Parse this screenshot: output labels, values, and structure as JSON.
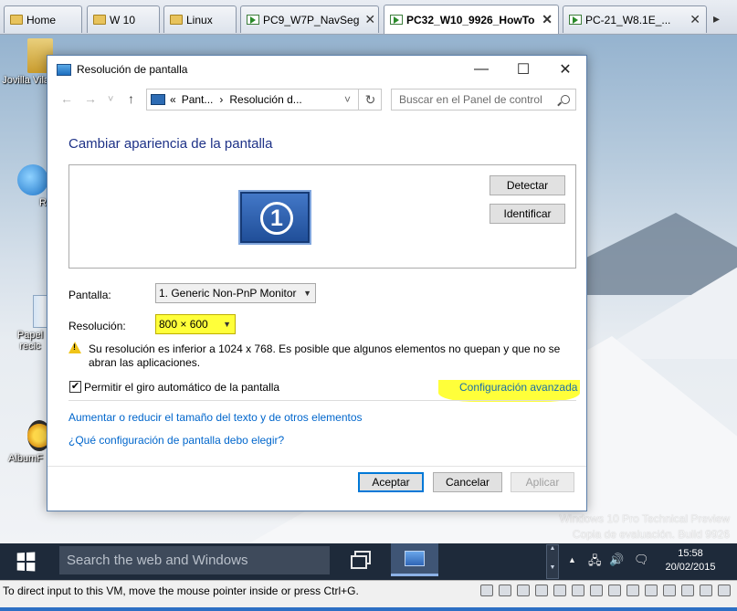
{
  "vm_tabs": [
    {
      "label": "Home",
      "icon": "home-folder-icon",
      "active": false
    },
    {
      "label": "W 10",
      "icon": "folder-icon",
      "active": false
    },
    {
      "label": "Linux",
      "icon": "folder-icon",
      "active": false
    },
    {
      "label": "PC9_W7P_NavSeg",
      "icon": "vm-icon",
      "active": false
    },
    {
      "label": "PC32_W10_9926_HowTo",
      "icon": "vm-running-icon",
      "active": true
    },
    {
      "label": "PC-21_W8.1E_...",
      "icon": "vm-icon",
      "active": false
    }
  ],
  "desktop": {
    "icons": [
      {
        "label": "Jovilla Vilar",
        "icon": "user-folder-icon"
      },
      {
        "label": "R",
        "icon": "network-globe-icon"
      },
      {
        "label": "Papel recic",
        "icon": "recycle-bin-icon"
      },
      {
        "label": "AlbumF",
        "icon": "album-shortcut-icon"
      }
    ],
    "watermark_line1": "Windows 10 Pro Technical Preview",
    "watermark_line2": "Copia de evaluación. Build 9926"
  },
  "window": {
    "title": "Resolución de pantalla",
    "minimize": "—",
    "maximize": "☐",
    "close": "✕",
    "nav_back": "←",
    "nav_forward": "→",
    "nav_recent": "˅",
    "nav_up": "↑",
    "breadcrumb_prefix": "«",
    "breadcrumb_1": "Pant...",
    "breadcrumb_sep": "›",
    "breadcrumb_2": "Resolución d...",
    "breadcrumb_dropdown": "˅",
    "refresh": "↻",
    "search_placeholder": "Buscar en el Panel de control",
    "heading": "Cambiar apariencia de la pantalla",
    "monitor_number": "1",
    "detect_button": "Detectar",
    "identify_button": "Identificar",
    "display_label": "Pantalla:",
    "display_value": "1. Generic Non-PnP Monitor",
    "resolution_label": "Resolución:",
    "resolution_value": "800 × 600",
    "warning_text": "Su resolución es inferior a 1024 x 768. Es posible que algunos elementos no quepan y que no se abran las aplicaciones.",
    "auto_rotate_label": "Permitir el giro automático de la pantalla",
    "auto_rotate_checked": true,
    "advanced_link": "Configuración avanzada",
    "text_size_link": "Aumentar o reducir el tamaño del texto y de otros elementos",
    "which_settings_link": "¿Qué configuración de pantalla debo elegir?",
    "ok_button": "Aceptar",
    "cancel_button": "Cancelar",
    "apply_button": "Aplicar",
    "highlight_color": "#ffff3a"
  },
  "taskbar": {
    "search_placeholder": "Search the web and Windows",
    "tray_time": "15:58",
    "tray_date": "20/02/2015",
    "tray_up_arrow": "▲",
    "tray_network": "🖧",
    "tray_volume": "🔊",
    "tray_notifications": "🗨"
  },
  "statusbar": {
    "text": "To direct input to this VM, move the mouse pointer inside or press Ctrl+G."
  }
}
